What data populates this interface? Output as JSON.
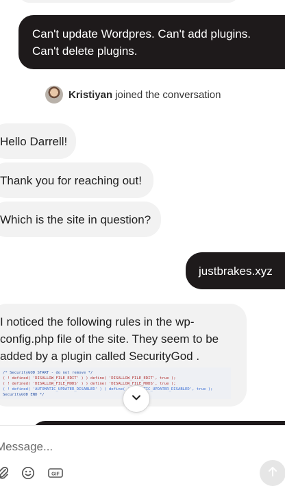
{
  "messages": [
    {
      "direction": "out",
      "text": "Can't update Wordpres. Can't add plugins.\nCan't delete plugins."
    },
    {
      "direction": "in",
      "text": "Hello Darrell!"
    },
    {
      "direction": "in",
      "text": "Thank you for reaching out!"
    },
    {
      "direction": "in",
      "text": "Which is the site in question?"
    },
    {
      "direction": "out",
      "text": "justbrakes.xyz"
    },
    {
      "direction": "in",
      "text": "I noticed the following rules in the wp-\nconfig.php file of the site. They seem to be\nadded by a plugin called SecurityGod ."
    }
  ],
  "join_notice": {
    "name": "Kristiyan",
    "text": "joined the conversation"
  },
  "code_snippet": [
    "/* SecurityGOD START - do not remove */",
    "( ! defined( 'DISALLOW_FILE_EDIT' ) ) define( 'DISALLOW_FILE_EDIT', true );",
    "( ! defined( 'DISALLOW_FILE_MODS' ) ) define( 'DISALLOW_FILE_MODS', true );",
    "( ! defined( 'AUTOMATIC_UPDATER_DISABLED' ) ) define( 'AUTOMATIC_UPDATER_DISABLED', true );",
    "SecurityGOD END */"
  ],
  "composer": {
    "placeholder": "Message...",
    "icons": [
      "paperclip-icon",
      "emoji-icon",
      "gif-icon",
      "send-arrow-icon"
    ]
  },
  "colors": {
    "outgoing_bubble": "#1e1a1b",
    "incoming_bubble": "#f2f2f2",
    "send_button": "#e6e6e6"
  }
}
